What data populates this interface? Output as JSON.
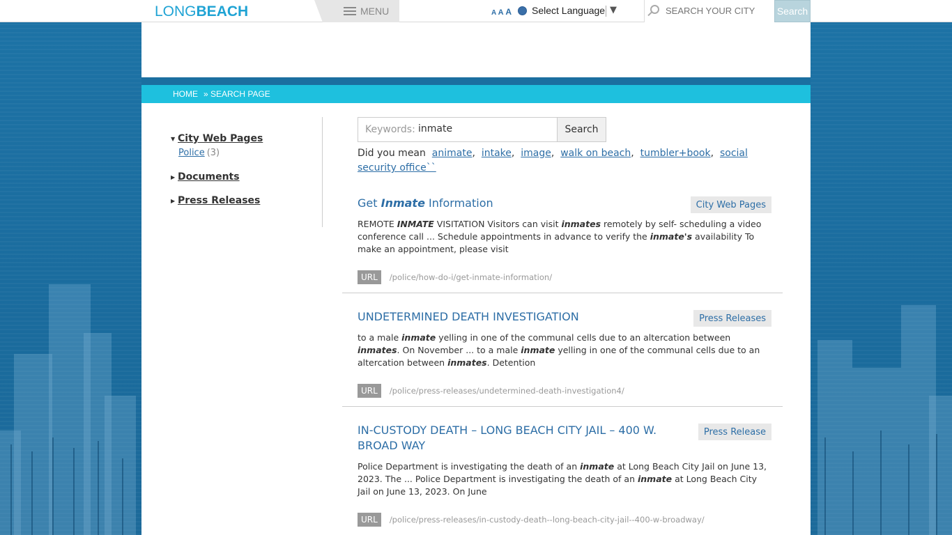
{
  "header": {
    "logo_long": "LONG",
    "logo_beach": "BEACH",
    "menu_label": "MENU",
    "font_size_small": "A",
    "font_size_medium": "A",
    "font_size_large": "A",
    "language_label": "Select Language",
    "language_arrow": "▼",
    "search_placeholder": "SEARCH YOUR CITY",
    "search_button": "Search"
  },
  "breadcrumb": {
    "home": "HOME",
    "current": "» SEARCH PAGE"
  },
  "sidebar": {
    "facets": [
      {
        "label": "City Web Pages",
        "expanded": true
      },
      {
        "label": "Documents",
        "expanded": false
      },
      {
        "label": "Press Releases",
        "expanded": false
      }
    ],
    "sub_label": "Police",
    "sub_count": "(3)"
  },
  "search": {
    "keywords_label": "Keywords:",
    "keywords_value": "inmate",
    "button": "Search",
    "did_you_mean_label": "Did you mean",
    "suggestions": [
      "animate",
      "intake",
      "image",
      "walk on beach",
      "tumbler+book",
      "social security office``"
    ]
  },
  "results": [
    {
      "title_pre": "Get ",
      "title_em": "Inmate",
      "title_post": " Information",
      "tag": "City Web Pages",
      "snippet": [
        {
          "t": "REMOTE "
        },
        {
          "b": "INMATE"
        },
        {
          "t": " VISITATION Visitors can visit "
        },
        {
          "b": "inmates"
        },
        {
          "t": " remotely by self- scheduling a video conference call ... Schedule appointments in advance to verify the "
        },
        {
          "b": "inmate's"
        },
        {
          "t": " availability To make an appointment, please visit"
        }
      ],
      "url_label": "URL",
      "url": "/police/how-do-i/get-inmate-information/"
    },
    {
      "title": "UNDETERMINED DEATH INVESTIGATION",
      "tag": "Press Releases",
      "snippet": [
        {
          "t": "to a male "
        },
        {
          "b": "inmate"
        },
        {
          "t": " yelling in one of the communal cells due to an altercation between "
        },
        {
          "b": "inmates"
        },
        {
          "t": ". On November ... to a male "
        },
        {
          "b": "inmate"
        },
        {
          "t": " yelling in one of the communal cells due to an altercation between "
        },
        {
          "b": "inmates"
        },
        {
          "t": ". Detention"
        }
      ],
      "url_label": "URL",
      "url": "/police/press-releases/undetermined-death-investigation4/"
    },
    {
      "title": "IN-CUSTODY DEATH – LONG BEACH CITY JAIL – 400 W. BROAD WAY",
      "tag": "Press Release",
      "snippet": [
        {
          "t": "Police Department is investigating the death of an "
        },
        {
          "b": "inmate"
        },
        {
          "t": " at Long Beach City Jail on June 13, 2023. The ... Police Department is investigating the death of an "
        },
        {
          "b": "inmate"
        },
        {
          "t": " at Long Beach City Jail on June 13, 2023. On June"
        }
      ],
      "url_label": "URL",
      "url": "/police/press-releases/in-custody-death--long-beach-city-jail--400-w-broadway/"
    }
  ],
  "colors": {
    "brand": "#1fa3d4",
    "link": "#2d6ea6",
    "breadcrumb_bar": "#1ec0de",
    "background": "#1b6fa0"
  }
}
